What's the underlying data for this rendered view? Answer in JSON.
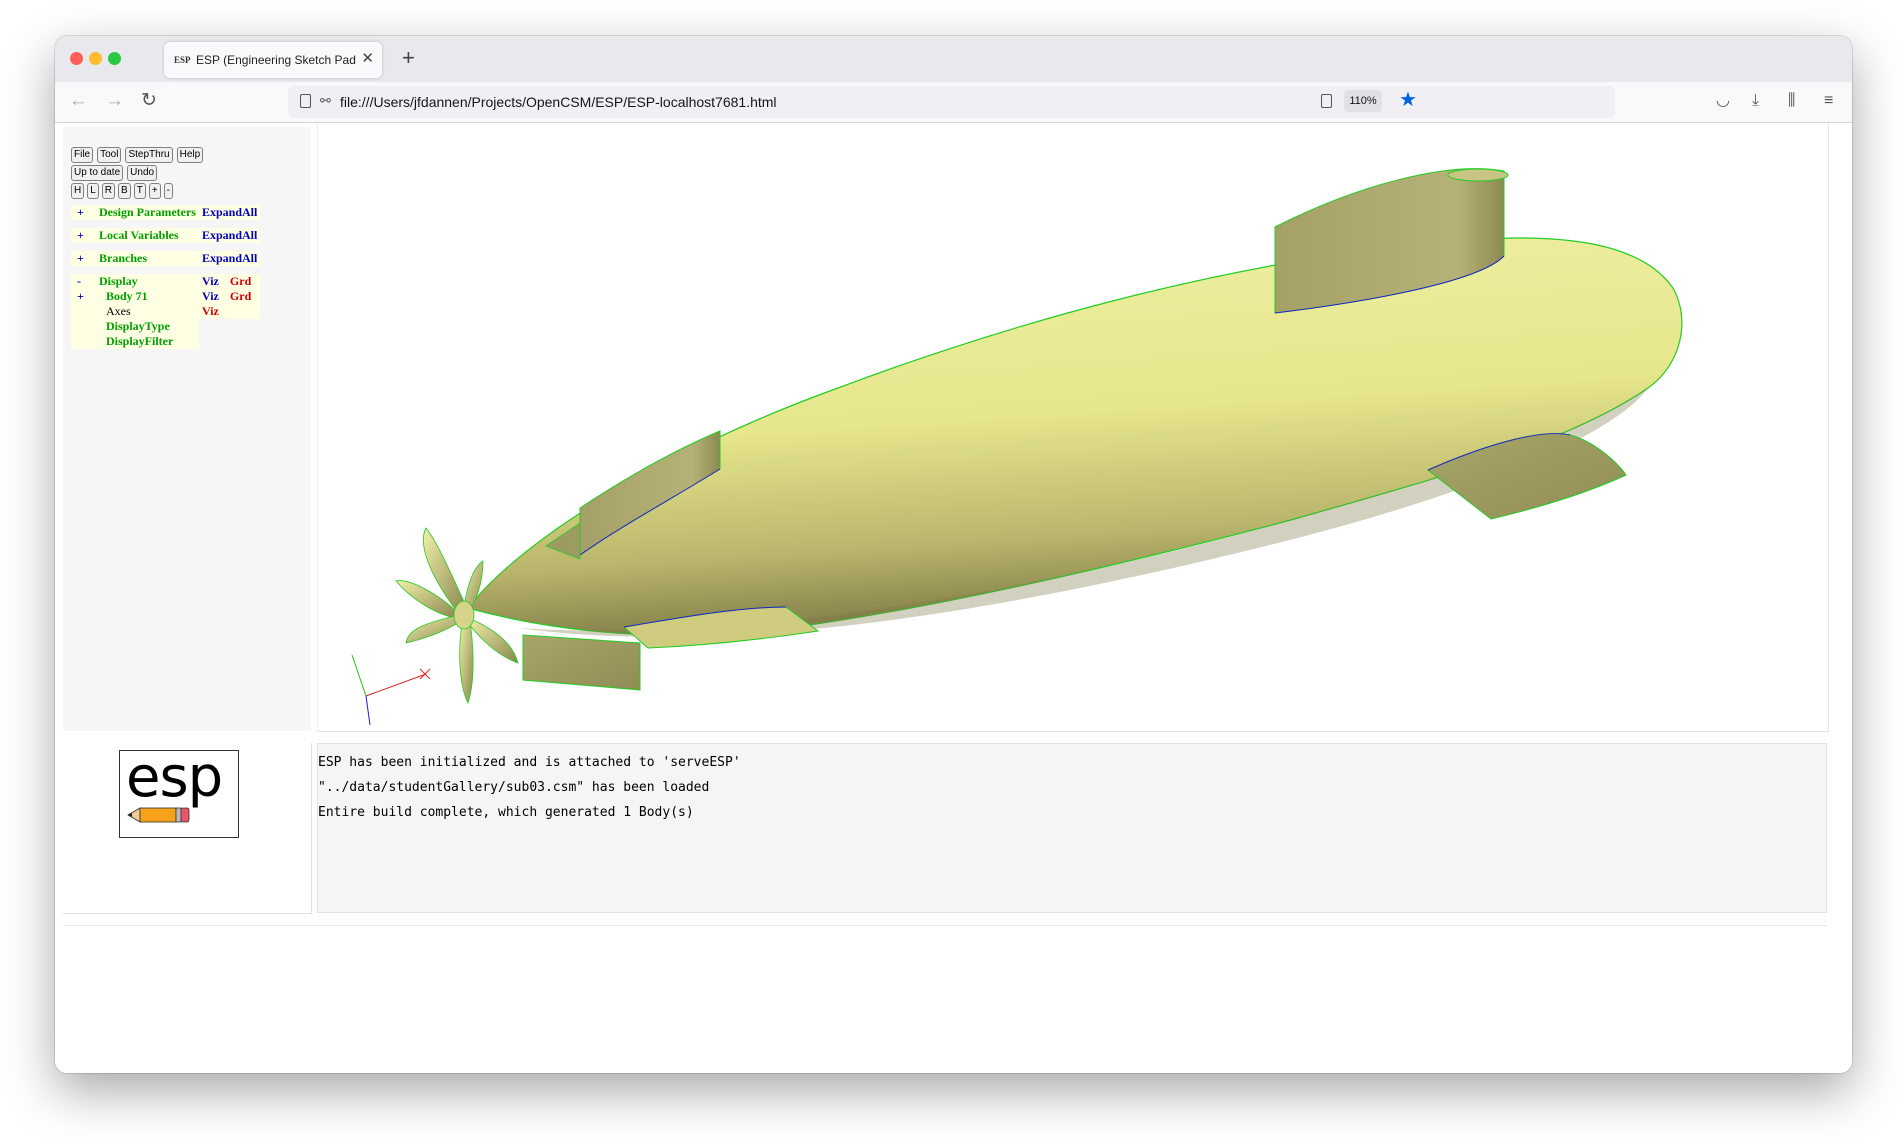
{
  "browser": {
    "tab_title": "ESP (Engineering Sketch Pad, V",
    "tab_favicon": "ESP",
    "url": "file:///Users/jfdannen/Projects/OpenCSM/ESP/ESP-localhost7681.html",
    "zoom": "110%",
    "icons": [
      "back-arrow-icon",
      "forward-arrow-icon",
      "reload-icon",
      "page-icon",
      "permissions-icon",
      "reader-view-icon",
      "bookmark-star-icon",
      "pocket-icon",
      "download-icon",
      "library-icon",
      "menu-icon"
    ],
    "accent_color": "#0061e0"
  },
  "toolbar": {
    "row1": [
      "File",
      "Tool",
      "StepThru",
      "Help"
    ],
    "row2": [
      "Up to date",
      "Undo"
    ],
    "row3": [
      "H",
      "L",
      "R",
      "B",
      "T",
      "+",
      "-"
    ]
  },
  "tree": {
    "design_parameters": {
      "toggle": "+",
      "label": "Design Parameters",
      "action": "ExpandAll"
    },
    "local_variables": {
      "toggle": "+",
      "label": "Local Variables",
      "action": "ExpandAll"
    },
    "branches": {
      "toggle": "+",
      "label": "Branches",
      "action": "ExpandAll"
    },
    "display": {
      "toggle": "-",
      "label": "Display",
      "viz": "Viz",
      "grd": "Grd"
    },
    "body": {
      "toggle": "+",
      "label": "Body 71",
      "viz": "Viz",
      "grd": "Grd"
    },
    "axes": {
      "label": "Axes",
      "viz": "Viz"
    },
    "display_type": {
      "label": "DisplayType"
    },
    "display_filter": {
      "label": "DisplayFilter"
    }
  },
  "colors": {
    "green_label": "#00a000",
    "blue_action": "#0000c0",
    "red_toggle": "#d00000",
    "body_fill": "#e8e890",
    "edge": "#22cc22"
  },
  "logo": {
    "text": "esp",
    "pencil_icon": "pencil-icon"
  },
  "messages": [
    "ESP has been initialized and is attached to 'serveESP'",
    "\"../data/studentGallery/sub03.csm\" has been loaded",
    "Entire build complete, which generated 1 Body(s)"
  ]
}
